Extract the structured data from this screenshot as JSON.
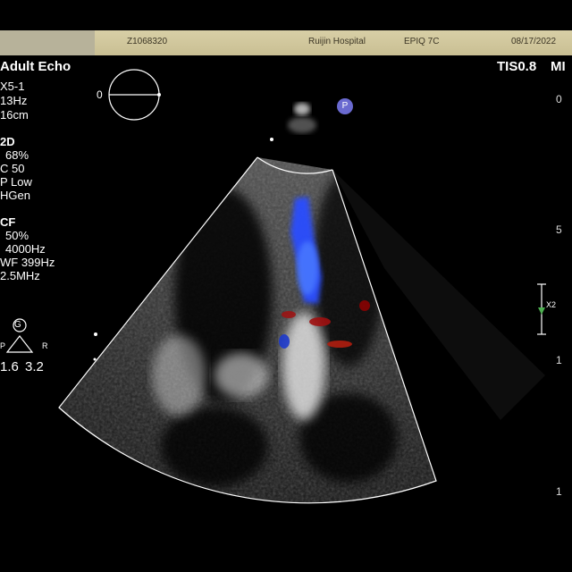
{
  "header": {
    "patient_id": "Z1068320",
    "hospital": "Ruijin Hospital",
    "system": "EPIQ 7C",
    "date": "08/17/2022"
  },
  "preset": {
    "mode": "Adult Echo",
    "probe": "X5-1",
    "frame_rate": "13Hz",
    "depth": "16cm"
  },
  "safety": {
    "tis": "TIS0.8",
    "mi": "MI"
  },
  "orientation": {
    "left_label": "0"
  },
  "two_d": {
    "title": "2D",
    "gain": "68%",
    "compress": "C 50",
    "power": "P Low",
    "mode": "HGen"
  },
  "color_flow": {
    "title": "CF",
    "gain": "50%",
    "prf": "4000Hz",
    "wall_filter": "WF 399Hz",
    "freq": "2.5MHz"
  },
  "probe_marker": "P",
  "gyro": {
    "letter": "G",
    "left": "P",
    "right": "R",
    "left_value": "1.6",
    "right_value": "3.2"
  },
  "depth_scale": {
    "t0": "0",
    "t5": "5",
    "t10": "1",
    "t15": "1"
  },
  "focus_label": "X2",
  "colors": {
    "flow_blue": "#2a4dff",
    "flow_red": "#b01010",
    "sector_outline": "#ffffff"
  }
}
